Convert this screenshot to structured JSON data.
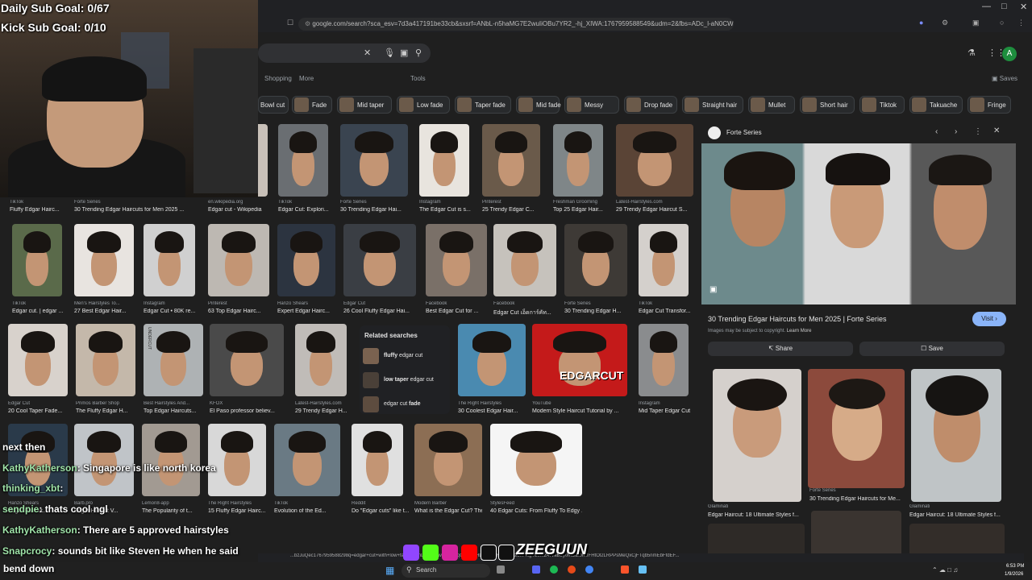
{
  "stream": {
    "daily_goal": "Daily Sub Goal: 0/67",
    "kick_goal": "Kick Sub Goal: 0/10",
    "subtitle": "bend down",
    "logo_text": "ZEEGUUN"
  },
  "chat": [
    {
      "user": "next then",
      "msg": ""
    },
    {
      "user": "KathyKatherson",
      "msg": ": Singapore is like north korea"
    },
    {
      "user": "thinking_xbt",
      "msg": ":"
    },
    {
      "user": "sendpie",
      "msg": ": thats cool ngl"
    },
    {
      "user": "KathyKatherson",
      "msg": ": There are 5 approved hairstyles"
    },
    {
      "user": "Snapcrocy",
      "msg": ": sounds bit like Steven He when he said"
    }
  ],
  "browser": {
    "url": "google.com/search?sca_esv=7d3a417191be33cb&sxsrf=ANbL-n5haMG7E2wuIiOBu7YR2_-hj_XIWA:1767959588549&udm=2&fbs=ADc_l-aN0CWEZB...",
    "avatar": "A",
    "saves": "Saves"
  },
  "nav": {
    "tabs": [
      "Shopping",
      "More",
      "Tools"
    ]
  },
  "chips": [
    "Bowl cut",
    "Fade",
    "Mid taper",
    "Low fade",
    "Taper fade",
    "Mid fade",
    "Messy",
    "Drop fade",
    "Straight hair",
    "Mullet",
    "Short hair",
    "Tiktok",
    "Takuache",
    "Fringe"
  ],
  "results": [
    {
      "src": "TikTok",
      "title": "Fluffy Edgar Hairc..."
    },
    {
      "src": "Forte Series",
      "title": "30 Trending Edgar Haircuts for Men 2025 ..."
    },
    {
      "src": "en.wikipedia.org",
      "title": "Edgar cut - Wikipedia"
    },
    {
      "src": "TikTok",
      "title": "Edgar Cut: Explori..."
    },
    {
      "src": "Forte Series",
      "title": "30 Trending Edgar Hai..."
    },
    {
      "src": "Instagram",
      "title": "The Edgar Cut is s..."
    },
    {
      "src": "Pinterest",
      "title": "25 Trendy Edgar C..."
    },
    {
      "src": "Freshman Grooming",
      "title": "Top 25 Edgar Hair..."
    },
    {
      "src": "Latest-Hairstyles.com",
      "title": "29 Trendy Edgar Haircut S..."
    },
    {
      "src": "TikTok",
      "title": "Edgar cut. | edgar ..."
    },
    {
      "src": "Men's Hairstyles To...",
      "title": "27 Best Edgar Hair..."
    },
    {
      "src": "Instagram",
      "title": "Edgar Cut • 80K re..."
    },
    {
      "src": "Pinterest",
      "title": "63 Top Edgar Hairc..."
    },
    {
      "src": "Hanzo Shears",
      "title": "Expert Edgar Hairc..."
    },
    {
      "src": "Edgar Cut",
      "title": "26 Cool Fluffy Edgar Hai..."
    },
    {
      "src": "Facebook",
      "title": "Best Edgar Cut for ..."
    },
    {
      "src": "Facebook",
      "title": "Edgar Cut เอ็ดการ์คัท..."
    },
    {
      "src": "Forte Series",
      "title": "30 Trending Edgar H..."
    },
    {
      "src": "TikTok",
      "title": "Edgar Cut Transfor..."
    },
    {
      "src": "Edgar Cut",
      "title": "20 Cool Taper Fade..."
    },
    {
      "src": "Primos Barber Shop",
      "title": "The Fluffy Edgar H..."
    },
    {
      "src": "Best Hairstyles And...",
      "title": "Top Edgar Haircuts..."
    },
    {
      "src": "KFOX",
      "title": "El Paso professor believ..."
    },
    {
      "src": "Latest-Hairstyles.com",
      "title": "29 Trendy Edgar H..."
    },
    {
      "src": "The Right Hairstyles",
      "title": "30 Coolest Edgar Hair..."
    },
    {
      "src": "YouTube",
      "title": "Modern Style Haircut Tutorial by ..."
    },
    {
      "src": "Instagram",
      "title": "Mid Taper Edgar Cut"
    },
    {
      "src": "Hanzo Shears",
      "title": "Edgar Haircut..."
    },
    {
      "src": "Barb.pro",
      "title": "Edgar Haircut V..."
    },
    {
      "src": "Lemon8-app",
      "title": "The Popularity of t..."
    },
    {
      "src": "The Right Hairstyles",
      "title": "15 Fluffy Edgar Hairc..."
    },
    {
      "src": "TikTok",
      "title": "Evolution of the Ed..."
    },
    {
      "src": "Reddit",
      "title": "Do \"Edgar cuts\" like t..."
    },
    {
      "src": "Modern Barber",
      "title": "What is the Edgar Cut? The Po..."
    },
    {
      "src": "StylesFeed",
      "title": "40 Edgar Cuts: From Fluffy To Edgy ..."
    }
  ],
  "related": {
    "heading": "Related searches",
    "items": [
      {
        "bold": "fluffy",
        "rest": " edgar cut"
      },
      {
        "bold": "low taper",
        "rest": " edgar cut"
      },
      {
        "bold": "",
        "rest": "edgar cut ",
        "bold2": "fade"
      }
    ]
  },
  "thumb_text": {
    "yt_overlay": "EDGARCUT",
    "book": "UNDERCUT"
  },
  "panel": {
    "source": "Forte Series",
    "title": "30 Trending Edgar Haircuts for Men 2025 | Forte Series",
    "visit": "Visit",
    "copyright": "Images may be subject to copyright.",
    "learn_more": "Learn More",
    "share": "Share",
    "save": "Save",
    "related": [
      {
        "src": "Glaminati",
        "title": "Edgar Haircut: 18 Ultimate Styles f..."
      },
      {
        "src": "Forte Series",
        "title": "30 Trending Edgar Haircuts for Me..."
      },
      {
        "src": "Glaminati",
        "title": "Edgar Haircut: 18 Ultimate Styles f..."
      }
    ]
  },
  "taskbar": {
    "search": "Search",
    "time": "6:53 PM",
    "date": "1/9/2026"
  },
  "status_url": "...bzJuQec1767959588298q=edgar+cut+with+low+fa... ...DmDMPs7avkOO4uqOEC1eHDR7-vGRB15T125m-NgTLemZ4rVaBby0mDZioIHIFHtOl2LRPPsMeQxCjFTqb5nmEbFfdEF..."
}
